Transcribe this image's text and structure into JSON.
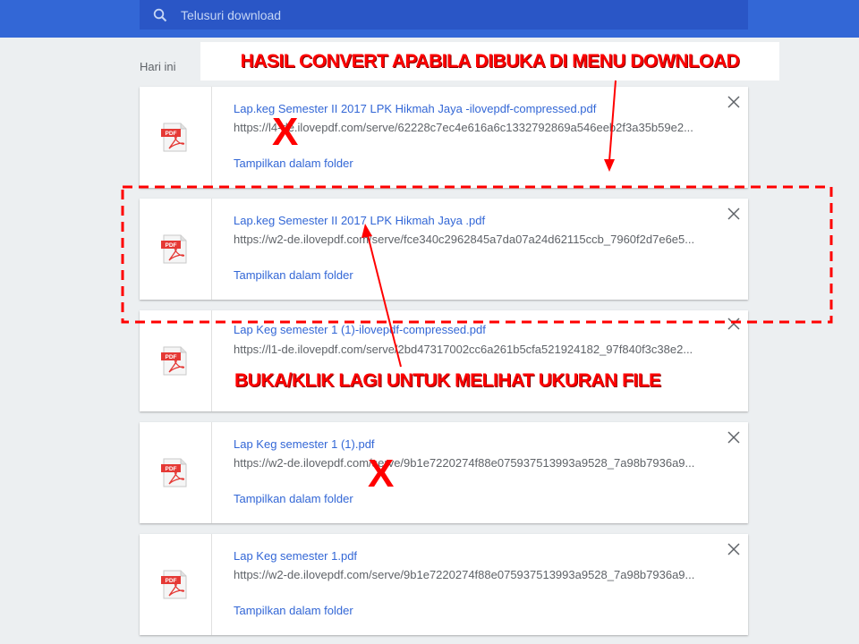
{
  "search": {
    "placeholder": "Telusuri download"
  },
  "group": {
    "date_label": "Hari ini"
  },
  "downloads": [
    {
      "name": "Lap.keg Semester II 2017 LPK Hikmah Jaya -ilovepdf-compressed.pdf",
      "url": "https://l4-de.ilovepdf.com/serve/62228c7ec4e616a6c1332792869a546eeb2f3a35b59e2...",
      "action": "Tampilkan dalam folder"
    },
    {
      "name": "Lap.keg Semester II 2017 LPK Hikmah Jaya .pdf",
      "url": "https://w2-de.ilovepdf.com/serve/fce340c2962845a7da07a24d62115ccb_7960f2d7e6e5...",
      "action": "Tampilkan dalam folder"
    },
    {
      "name": "Lap Keg semester 1 (1)-ilovepdf-compressed.pdf",
      "url": "https://l1-de.ilovepdf.com/serve/2bd47317002cc6a261b5cfa521924182_97f840f3c38e2...",
      "action": ""
    },
    {
      "name": "Lap Keg semester 1 (1).pdf",
      "url": "https://w2-de.ilovepdf.com/serve/9b1e7220274f88e075937513993a9528_7a98b7936a9...",
      "action": "Tampilkan dalam folder"
    },
    {
      "name": "Lap Keg semester 1.pdf",
      "url": "https://w2-de.ilovepdf.com/serve/9b1e7220274f88e075937513993a9528_7a98b7936a9...",
      "action": "Tampilkan dalam folder"
    }
  ],
  "annotations": {
    "top": "HASIL CONVERT APABILA DIBUKA DI MENU DOWNLOAD",
    "middle": "BUKA/KLIK LAGI UNTUK MELIHAT UKURAN FILE",
    "mark_1": "X",
    "mark_2": "X"
  },
  "colors": {
    "header": "#3367d6",
    "search_bar": "#2a56c6",
    "link": "#3367d6",
    "annotation": "#ff0000",
    "pdf_red": "#e53935"
  }
}
